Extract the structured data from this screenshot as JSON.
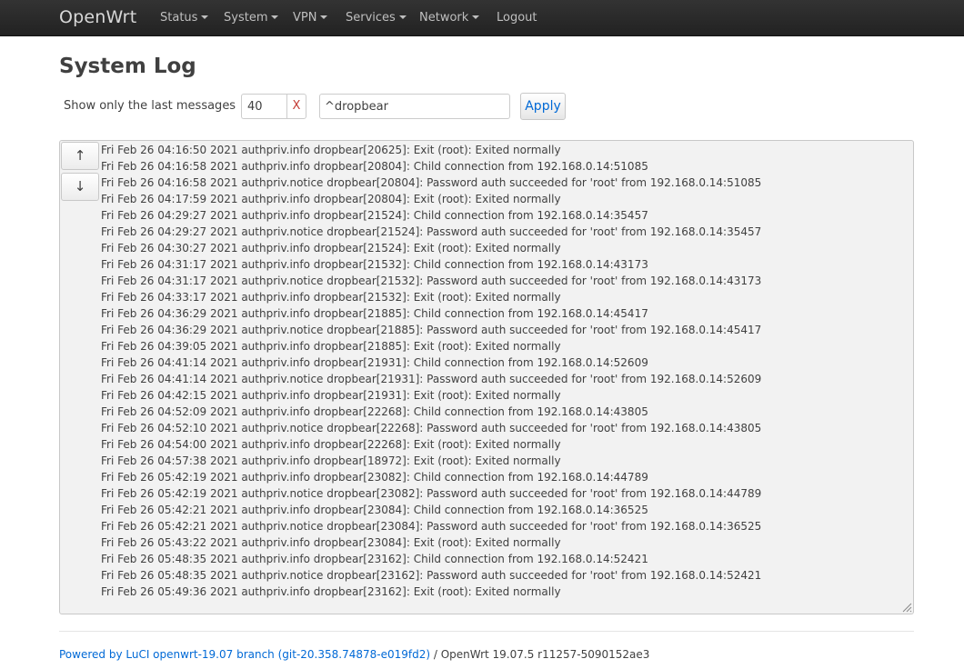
{
  "navbar": {
    "brand": "OpenWrt",
    "items": [
      {
        "label": "Status",
        "has_menu": true
      },
      {
        "label": "System",
        "has_menu": true
      },
      {
        "label": "VPN",
        "has_menu": true
      },
      {
        "label": "Services",
        "has_menu": true
      },
      {
        "label": "Network",
        "has_menu": true
      },
      {
        "label": "Logout",
        "has_menu": false
      }
    ]
  },
  "page": {
    "title": "System Log"
  },
  "controls": {
    "lines_label": "Show only the last messages",
    "lines_value": "40",
    "clear_label": "X",
    "filter_value": "^dropbear",
    "apply_label": "Apply"
  },
  "log": {
    "scroll_up_icon": "↑",
    "scroll_down_icon": "↓",
    "lines": [
      "Fri Feb 26 04:16:50 2021 authpriv.info dropbear[20625]: Exit (root): Exited normally",
      "Fri Feb 26 04:16:58 2021 authpriv.info dropbear[20804]: Child connection from 192.168.0.14:51085",
      "Fri Feb 26 04:16:58 2021 authpriv.notice dropbear[20804]: Password auth succeeded for 'root' from 192.168.0.14:51085",
      "Fri Feb 26 04:17:59 2021 authpriv.info dropbear[20804]: Exit (root): Exited normally",
      "Fri Feb 26 04:29:27 2021 authpriv.info dropbear[21524]: Child connection from 192.168.0.14:35457",
      "Fri Feb 26 04:29:27 2021 authpriv.notice dropbear[21524]: Password auth succeeded for 'root' from 192.168.0.14:35457",
      "Fri Feb 26 04:30:27 2021 authpriv.info dropbear[21524]: Exit (root): Exited normally",
      "Fri Feb 26 04:31:17 2021 authpriv.info dropbear[21532]: Child connection from 192.168.0.14:43173",
      "Fri Feb 26 04:31:17 2021 authpriv.notice dropbear[21532]: Password auth succeeded for 'root' from 192.168.0.14:43173",
      "Fri Feb 26 04:33:17 2021 authpriv.info dropbear[21532]: Exit (root): Exited normally",
      "Fri Feb 26 04:36:29 2021 authpriv.info dropbear[21885]: Child connection from 192.168.0.14:45417",
      "Fri Feb 26 04:36:29 2021 authpriv.notice dropbear[21885]: Password auth succeeded for 'root' from 192.168.0.14:45417",
      "Fri Feb 26 04:39:05 2021 authpriv.info dropbear[21885]: Exit (root): Exited normally",
      "Fri Feb 26 04:41:14 2021 authpriv.info dropbear[21931]: Child connection from 192.168.0.14:52609",
      "Fri Feb 26 04:41:14 2021 authpriv.notice dropbear[21931]: Password auth succeeded for 'root' from 192.168.0.14:52609",
      "Fri Feb 26 04:42:15 2021 authpriv.info dropbear[21931]: Exit (root): Exited normally",
      "Fri Feb 26 04:52:09 2021 authpriv.info dropbear[22268]: Child connection from 192.168.0.14:43805",
      "Fri Feb 26 04:52:10 2021 authpriv.notice dropbear[22268]: Password auth succeeded for 'root' from 192.168.0.14:43805",
      "Fri Feb 26 04:54:00 2021 authpriv.info dropbear[22268]: Exit (root): Exited normally",
      "Fri Feb 26 04:57:38 2021 authpriv.info dropbear[18972]: Exit (root): Exited normally",
      "Fri Feb 26 05:42:19 2021 authpriv.info dropbear[23082]: Child connection from 192.168.0.14:44789",
      "Fri Feb 26 05:42:19 2021 authpriv.notice dropbear[23082]: Password auth succeeded for 'root' from 192.168.0.14:44789",
      "Fri Feb 26 05:42:21 2021 authpriv.info dropbear[23084]: Child connection from 192.168.0.14:36525",
      "Fri Feb 26 05:42:21 2021 authpriv.notice dropbear[23084]: Password auth succeeded for 'root' from 192.168.0.14:36525",
      "Fri Feb 26 05:43:22 2021 authpriv.info dropbear[23084]: Exit (root): Exited normally",
      "Fri Feb 26 05:48:35 2021 authpriv.info dropbear[23162]: Child connection from 192.168.0.14:52421",
      "Fri Feb 26 05:48:35 2021 authpriv.notice dropbear[23162]: Password auth succeeded for 'root' from 192.168.0.14:52421",
      "Fri Feb 26 05:49:36 2021 authpriv.info dropbear[23162]: Exit (root): Exited normally"
    ]
  },
  "footer": {
    "link_text": "Powered by LuCI openwrt-19.07 branch (git-20.358.74878-e019fd2)",
    "version_text": " / OpenWrt 19.07.5 r11257-5090152ae3"
  },
  "colors": {
    "navbar_bg": "#222222",
    "link": "#0069d6",
    "clear_x": "#c43c35",
    "log_bg": "#f2f2f2"
  }
}
